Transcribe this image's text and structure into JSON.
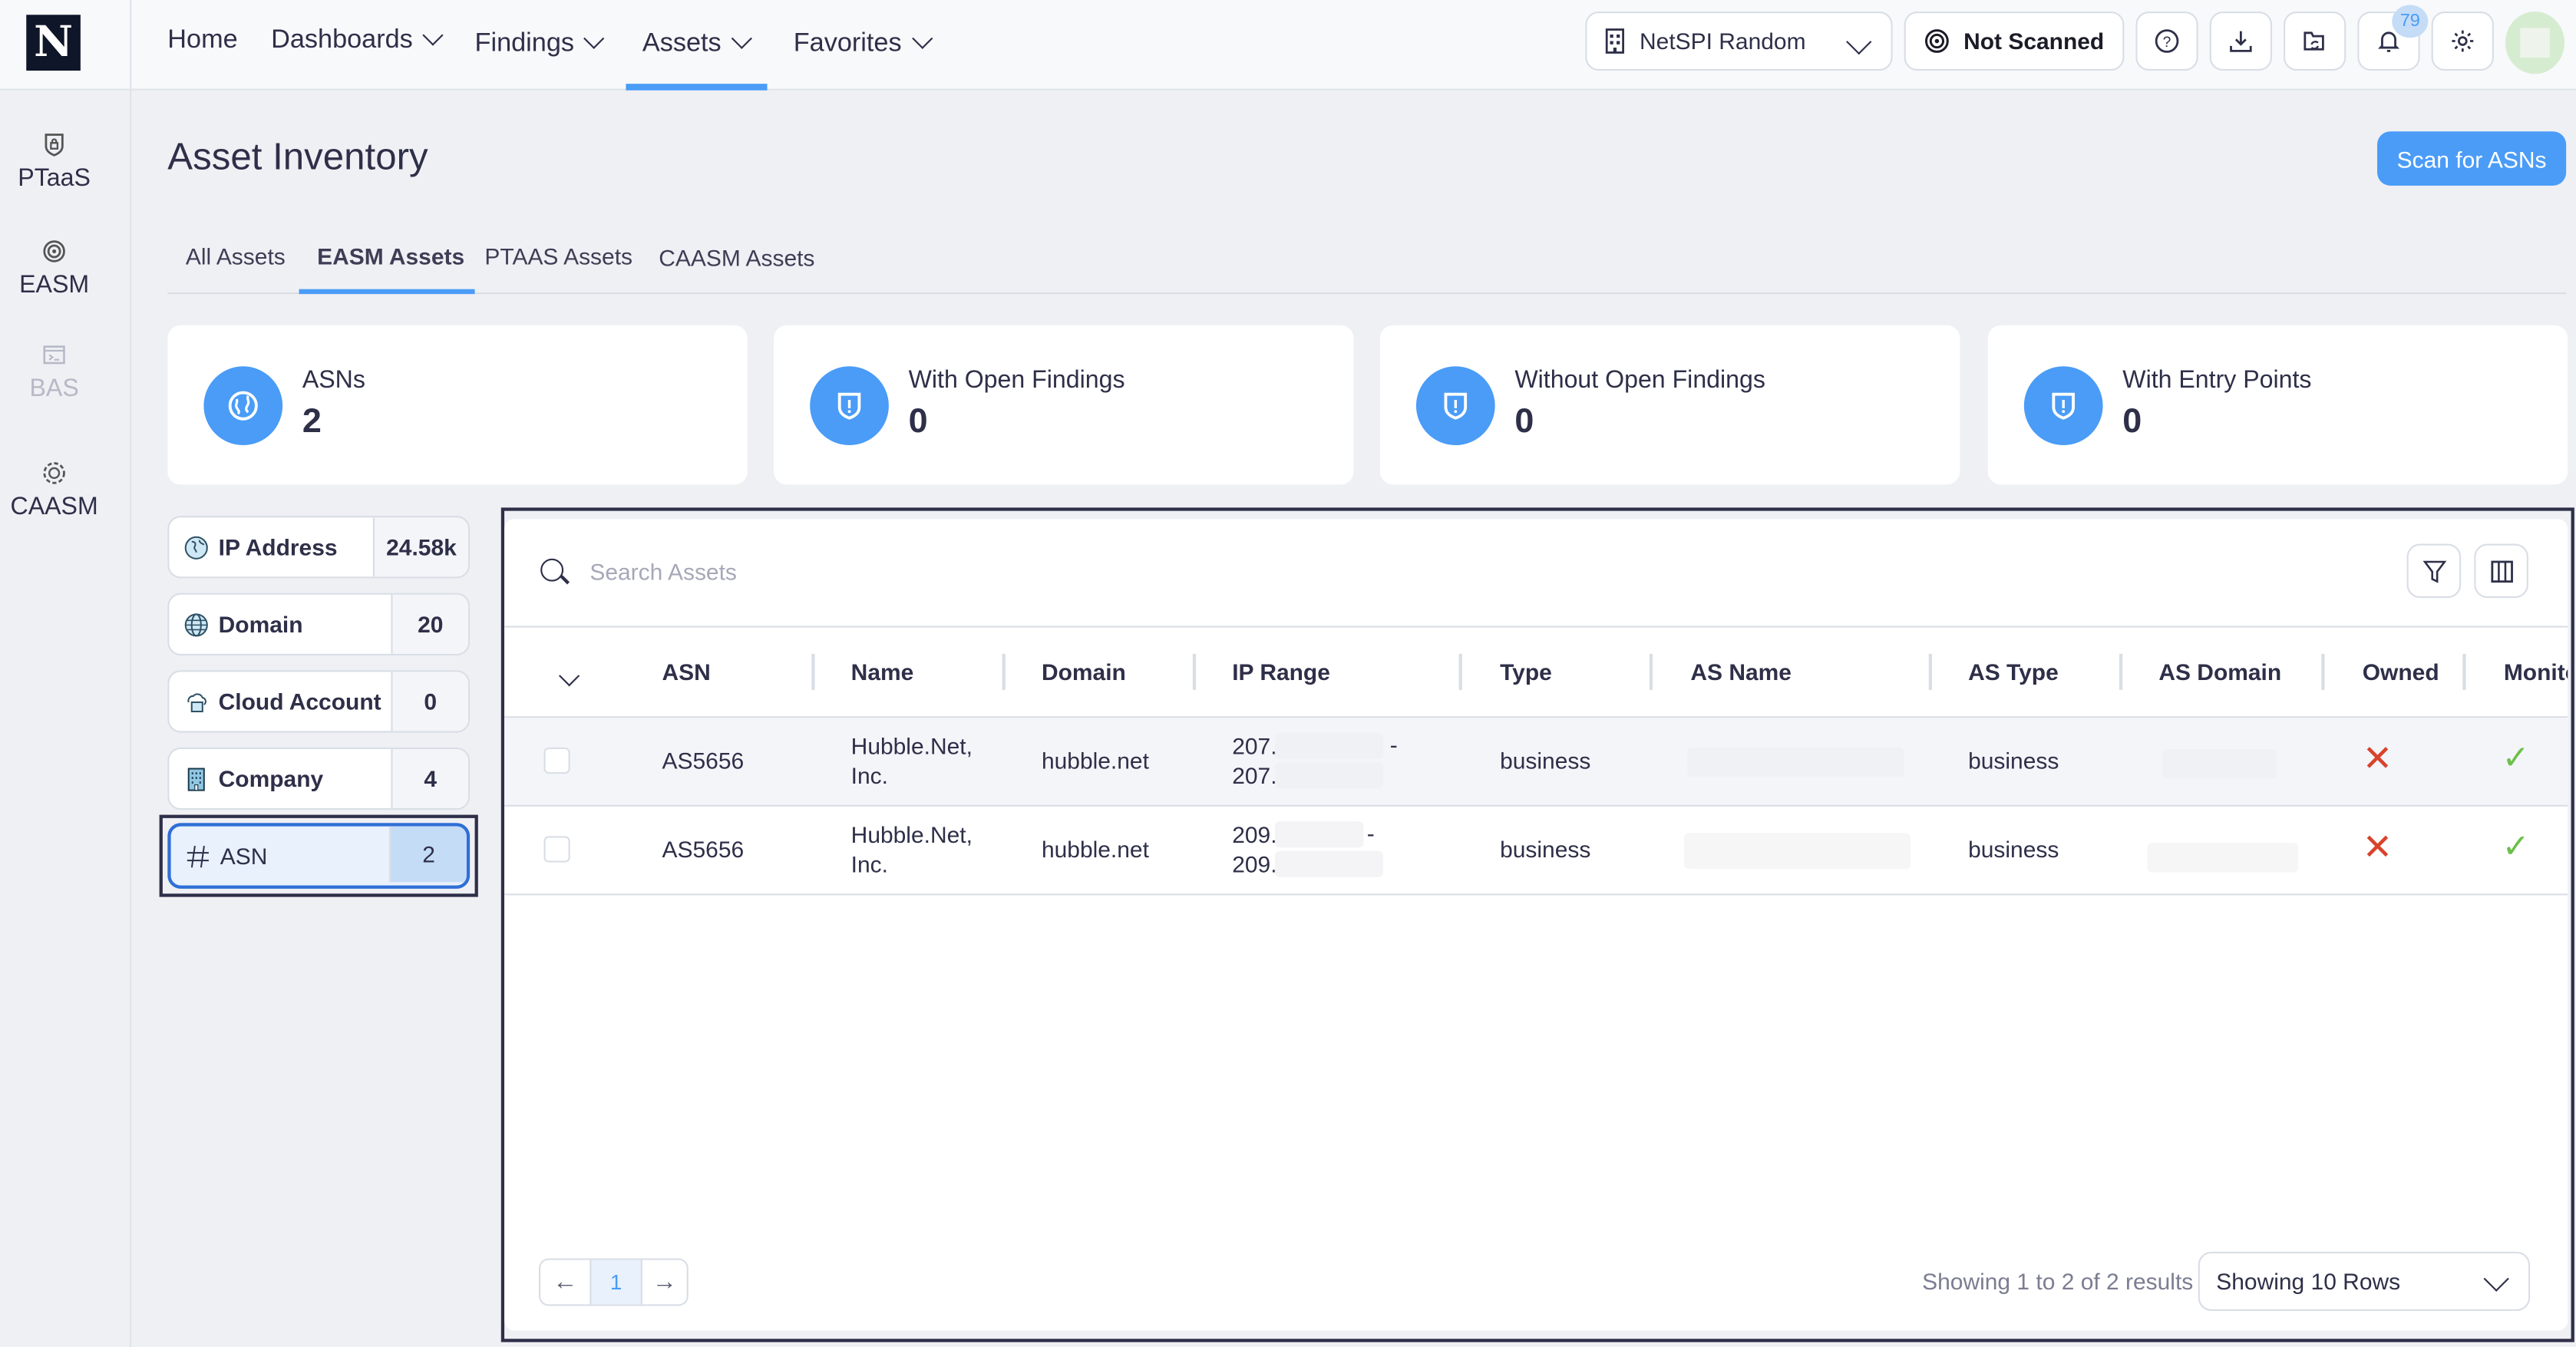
{
  "brand": {
    "logo_letter": "N"
  },
  "nav": {
    "items": [
      {
        "label": "Home",
        "has_menu": false
      },
      {
        "label": "Dashboards",
        "has_menu": true
      },
      {
        "label": "Findings",
        "has_menu": true
      },
      {
        "label": "Assets",
        "has_menu": true,
        "active": true
      },
      {
        "label": "Favorites",
        "has_menu": true
      }
    ]
  },
  "toolbar": {
    "org_selector": "NetSPI Random",
    "scan_status": "Not Scanned",
    "notifications_count": "79",
    "icons": [
      "help-icon",
      "download-icon",
      "folder-sync-icon",
      "bell-icon",
      "gear-icon"
    ]
  },
  "rail": {
    "items": [
      {
        "label": "PTaaS",
        "icon": "shield-lock-icon",
        "disabled": false
      },
      {
        "label": "EASM",
        "icon": "radar-target-icon",
        "disabled": false
      },
      {
        "label": "BAS",
        "icon": "terminal-icon",
        "disabled": true
      },
      {
        "label": "CAASM",
        "icon": "dashed-globe-icon",
        "disabled": false
      }
    ]
  },
  "page": {
    "title": "Asset Inventory",
    "primary_action": "Scan for ASNs",
    "tabs": [
      {
        "label": "All Assets",
        "active": false
      },
      {
        "label": "EASM Assets",
        "active": true
      },
      {
        "label": "PTAAS Assets",
        "active": false
      },
      {
        "label": "CAASM Assets",
        "active": false
      }
    ]
  },
  "stats": [
    {
      "label": "ASNs",
      "value": "2",
      "icon": "asn-globe-icon"
    },
    {
      "label": "With Open Findings",
      "value": "0",
      "icon": "shield-alert-icon"
    },
    {
      "label": "Without Open Findings",
      "value": "0",
      "icon": "shield-alert-icon"
    },
    {
      "label": "With Entry Points",
      "value": "0",
      "icon": "shield-alert-icon"
    }
  ],
  "categories": [
    {
      "label": "IP Address",
      "count": "24.58k",
      "icon": "globe-africa-icon",
      "selected": false
    },
    {
      "label": "Domain",
      "count": "20",
      "icon": "globe-icon",
      "selected": false
    },
    {
      "label": "Cloud Account",
      "count": "0",
      "icon": "cloud-folder-icon",
      "selected": false
    },
    {
      "label": "Company",
      "count": "4",
      "icon": "building-icon",
      "selected": false
    },
    {
      "label": "ASN",
      "count": "2",
      "icon": "hash-icon",
      "selected": true
    }
  ],
  "table": {
    "search_placeholder": "Search Assets",
    "columns": [
      "ASN",
      "Name",
      "Domain",
      "IP Range",
      "Type",
      "AS Name",
      "AS Type",
      "AS Domain",
      "Owned",
      "Monito"
    ],
    "rows": [
      {
        "asn": "AS5656",
        "name_line1": "Hubble.Net,",
        "name_line2": "Inc.",
        "domain": "hubble.net",
        "ip_start": "207.",
        "ip_end": "207.",
        "ip_sep": "-",
        "type": "business",
        "as_name": "",
        "as_type": "business",
        "as_domain": "",
        "owned": false,
        "monitored": true
      },
      {
        "asn": "AS5656",
        "name_line1": "Hubble.Net,",
        "name_line2": "Inc.",
        "domain": "hubble.net",
        "ip_start": "209.",
        "ip_end": "209.",
        "ip_sep": "-",
        "type": "business",
        "as_name": "",
        "as_type": "business",
        "as_domain": "",
        "owned": false,
        "monitored": true
      }
    ],
    "status_marks": {
      "false": "✕",
      "true": "✓"
    },
    "colors": {
      "no": "#d8432c",
      "yes": "#6cc04a"
    }
  },
  "pagination": {
    "current_page": "1",
    "results_text": "Showing 1 to 2 of 2 results",
    "rows_select": "Showing 10 Rows"
  },
  "colors": {
    "accent": "#4a9cf7",
    "text": "#2e2f48",
    "background": "#eff0f4"
  }
}
